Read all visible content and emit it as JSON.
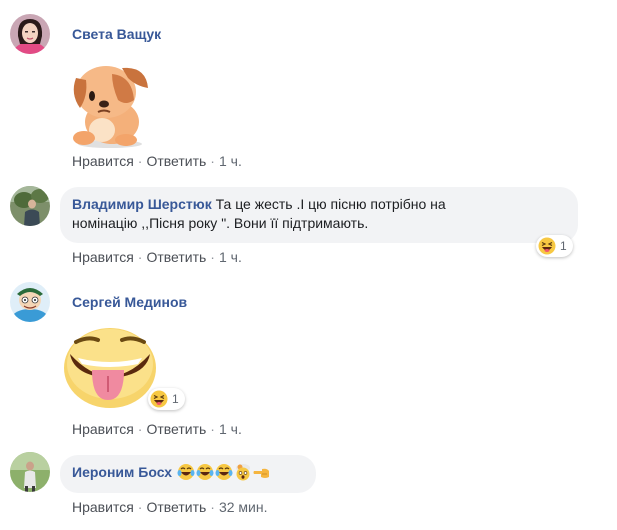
{
  "comments": [
    {
      "author": "Света Ващук",
      "sticker": "puppy-facepalm-sticker",
      "actions": {
        "like": "Нравится",
        "reply": "Ответить",
        "time": "1 ч."
      }
    },
    {
      "author": "Владимир Шерстюк",
      "text_line1": "Та це жесть .І цю пісню потрібно на",
      "text_line2": "номінацію ,,Пісня року \". Вони її підтримають.",
      "reaction": {
        "icon": "haha-icon",
        "count": "1"
      },
      "actions": {
        "like": "Нравится",
        "reply": "Ответить",
        "time": "1 ч."
      }
    },
    {
      "author": "Сергей Мединов",
      "sticker": "tongue-out-face-sticker",
      "reaction": {
        "icon": "haha-icon",
        "count": "1"
      },
      "actions": {
        "like": "Нравится",
        "reply": "Ответить",
        "time": "1 ч."
      }
    },
    {
      "author": "Иероним Босх",
      "emojis": [
        "tears-of-joy",
        "tears-of-joy",
        "tears-of-joy",
        "exploding-head",
        "pointing-left"
      ],
      "actions": {
        "like": "Нравится",
        "reply": "Ответить",
        "time": "32 мин."
      }
    }
  ],
  "colors": {
    "author": "#385898",
    "bubble": "#f2f3f5",
    "meta": "#606770"
  }
}
